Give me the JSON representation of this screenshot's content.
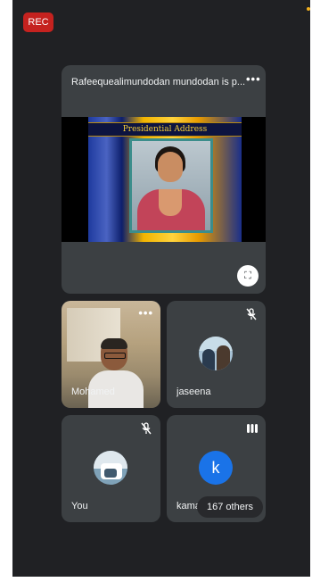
{
  "rec_badge": "REC",
  "presentation": {
    "title": "Rafeequealimundodan mundodan is p...",
    "more_icon": "more-horiz-icon",
    "slide_banner": "Presidential Address",
    "fullscreen_icon": "fullscreen-icon"
  },
  "participants": [
    {
      "name": "Mohamed",
      "mic": "on",
      "more_icon": "more-horiz-icon"
    },
    {
      "name": "jaseena",
      "mic": "muted",
      "icon": "mic-off-icon"
    },
    {
      "name": "You",
      "mic": "muted",
      "icon": "mic-off-icon"
    },
    {
      "name": "kama",
      "avatar_letter": "k",
      "avatar_color": "#1a73e8",
      "icon": "audio-level-icon"
    }
  ],
  "others_pill": "167 others",
  "colors": {
    "background": "#202124",
    "tile": "#3c4043",
    "rec": "#c5221f"
  }
}
